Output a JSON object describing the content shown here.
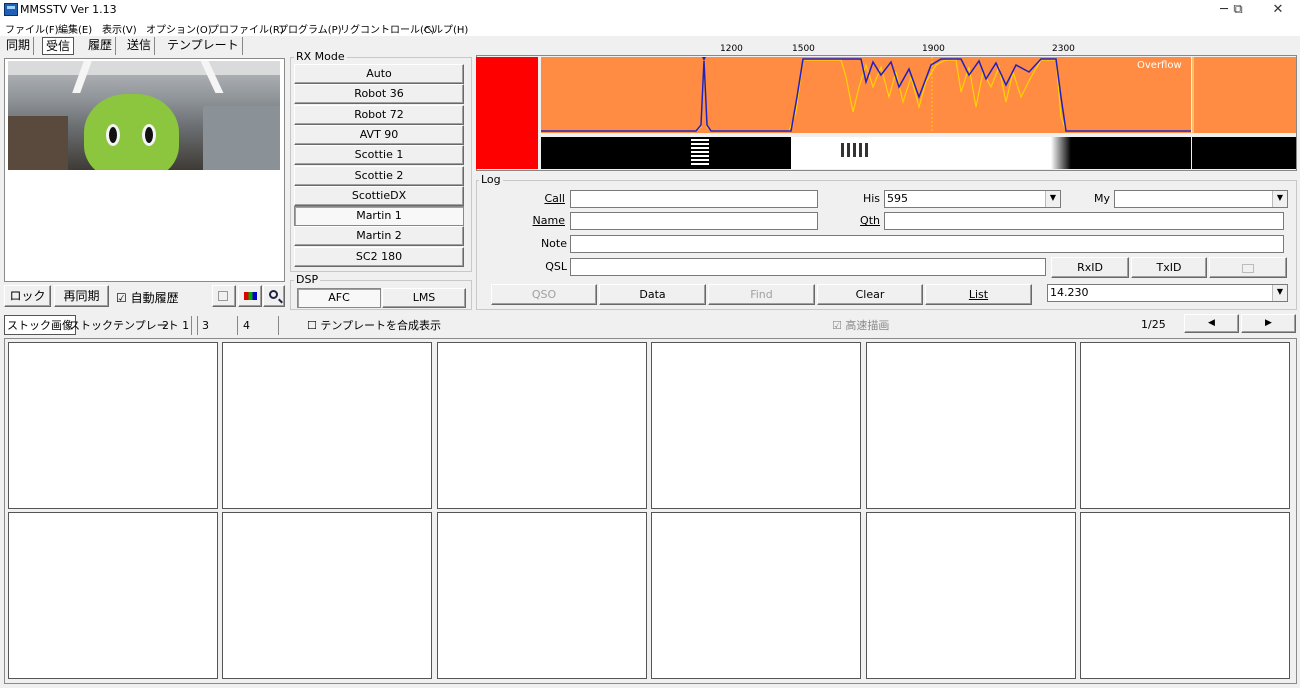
{
  "window": {
    "title": "MMSSTV Ver 1.13",
    "min": "─",
    "restore": "⧉",
    "close": "✕"
  },
  "menu": [
    "ファイル(F)",
    "編集(E)",
    "表示(V)",
    "オプション(O)",
    "プロファイル(R)",
    "プログラム(P)",
    "リグコントロール(C)",
    "ヘルプ(H)"
  ],
  "tabs": {
    "sync": "同期",
    "rx": "受信",
    "history": "履歴",
    "tx": "送信",
    "template": "テンプレート"
  },
  "left_controls": {
    "lock": "ロック",
    "resync": "再同期",
    "auto_history": "自動履歴",
    "auto_history_checked": "☑"
  },
  "rx_mode": {
    "label": "RX Mode",
    "modes": [
      "Auto",
      "Robot 36",
      "Robot 72",
      "AVT 90",
      "Scottie 1",
      "Scottie 2",
      "ScottieDX",
      "Martin 1",
      "Martin 2",
      "SC2 180"
    ],
    "selected": "Martin 1"
  },
  "dsp": {
    "label": "DSP",
    "afc": "AFC",
    "lms": "LMS"
  },
  "spectrum": {
    "ticks": [
      "1200",
      "1500",
      "1900",
      "2300"
    ],
    "overflow": "Overflow",
    "bg_color": "#ff8c42",
    "signal_color": "#ffd200",
    "trace_color": "#2020c0"
  },
  "log": {
    "label": "Log",
    "call_label": "Call",
    "call_value": "",
    "his_label": "His",
    "his_value": "595",
    "my_label": "My",
    "my_value": "",
    "name_label": "Name",
    "name_value": "",
    "qth_label": "Qth",
    "qth_value": "",
    "note_label": "Note",
    "note_value": "",
    "qsl_label": "QSL",
    "qsl_value": "",
    "rxid": "RxID",
    "txid": "TxID",
    "qso": "QSO",
    "data": "Data",
    "find": "Find",
    "clear": "Clear",
    "list": "List",
    "freq": "14.230"
  },
  "stock_tabs": [
    "ストック画像",
    "ストックテンプレート 1",
    "2",
    "3",
    "4"
  ],
  "composite": {
    "label": "テンプレートを合成表示",
    "checked": "☐"
  },
  "fast_draw": {
    "label": "高速描画",
    "checked": "☑"
  },
  "pager": {
    "page": "1/25",
    "prev": "◀",
    "next": "▶"
  }
}
